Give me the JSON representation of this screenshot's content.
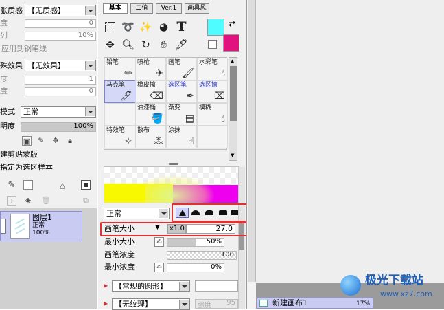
{
  "left_panel": {
    "paper_texture": {
      "label": "张质感",
      "value": "【无质感】"
    },
    "texture_row1": {
      "label": "度",
      "value": "0"
    },
    "texture_row2": {
      "label": "列",
      "value": "10%"
    },
    "apply_to_pen_label": "应用到钢笔线",
    "effect": {
      "label": "殊效果",
      "value": "【无效果】"
    },
    "effect_row1": {
      "label": "度",
      "value": "1"
    },
    "effect_row2": {
      "label": "度",
      "value": "0"
    },
    "blend_mode": {
      "label": "模式",
      "value": "正常"
    },
    "opacity": {
      "label": "明度",
      "value": "100%",
      "level": 100
    },
    "clipping_label": "建剪贴蒙版",
    "selection_source_label": "指定为选区样本",
    "layer": {
      "name": "图层1",
      "mode": "正常",
      "opacity": "100%"
    }
  },
  "tool_tabs": [
    "基本",
    "二值",
    "Ver.1",
    "画具风"
  ],
  "tools": [
    "select-rect-icon",
    "lasso-icon",
    "magic-wand-icon",
    "selection-pen-icon",
    "text-icon",
    "move-icon",
    "zoom-icon",
    "rotate-icon",
    "hand-icon",
    "eyedropper-icon"
  ],
  "colors": {
    "primary": "#4ffcff",
    "secondary": "#e0137f",
    "accent": "#e23030"
  },
  "brushes": [
    {
      "label": "铅笔",
      "icon": "pencil-icon",
      "state": "normal"
    },
    {
      "label": "喷枪",
      "icon": "airbrush-icon",
      "state": "normal"
    },
    {
      "label": "画笔",
      "icon": "brush-icon",
      "state": "normal"
    },
    {
      "label": "水彩笔",
      "icon": "watercolor-icon",
      "state": "normal"
    },
    {
      "label": "马克笔",
      "icon": "marker-icon",
      "state": "selected"
    },
    {
      "label": "橡皮擦",
      "icon": "eraser-icon",
      "state": "normal"
    },
    {
      "label": "选区笔",
      "icon": "selection-pen-icon",
      "state": "blue"
    },
    {
      "label": "选区擦",
      "icon": "selection-eraser-icon",
      "state": "blue"
    },
    {
      "label": "",
      "icon": "",
      "state": "empty"
    },
    {
      "label": "油漆桶",
      "icon": "bucket-icon",
      "state": "normal"
    },
    {
      "label": "渐变",
      "icon": "gradient-icon",
      "state": "normal"
    },
    {
      "label": "模糊",
      "icon": "blur-icon",
      "state": "normal"
    },
    {
      "label": "特效笔",
      "icon": "effect-pen-icon",
      "state": "normal"
    },
    {
      "label": "散布",
      "icon": "scatter-icon",
      "state": "normal"
    },
    {
      "label": "涂抹",
      "icon": "smudge-icon",
      "state": "normal"
    },
    {
      "label": "",
      "icon": "",
      "state": "empty"
    }
  ],
  "brush_settings": {
    "blend_mode": "正常",
    "size": {
      "label": "画笔大小",
      "multiplier": "x1.0",
      "value": "27.0"
    },
    "min_size": {
      "label": "最小大小",
      "value": "50%",
      "level": 50
    },
    "density": {
      "label": "画笔浓度",
      "value": "100",
      "level": 100
    },
    "min_density": {
      "label": "最小浓度",
      "value": "0%",
      "level": 0
    },
    "shape": "【常规的圆形】",
    "texture": "【无纹理】",
    "texture_strength": {
      "label": "强度",
      "value": "95"
    }
  },
  "navigator": {
    "name": "新建画布1",
    "zoom": "17%"
  },
  "watermark": {
    "name": "极光下载站",
    "url": "www.xz7.com"
  }
}
